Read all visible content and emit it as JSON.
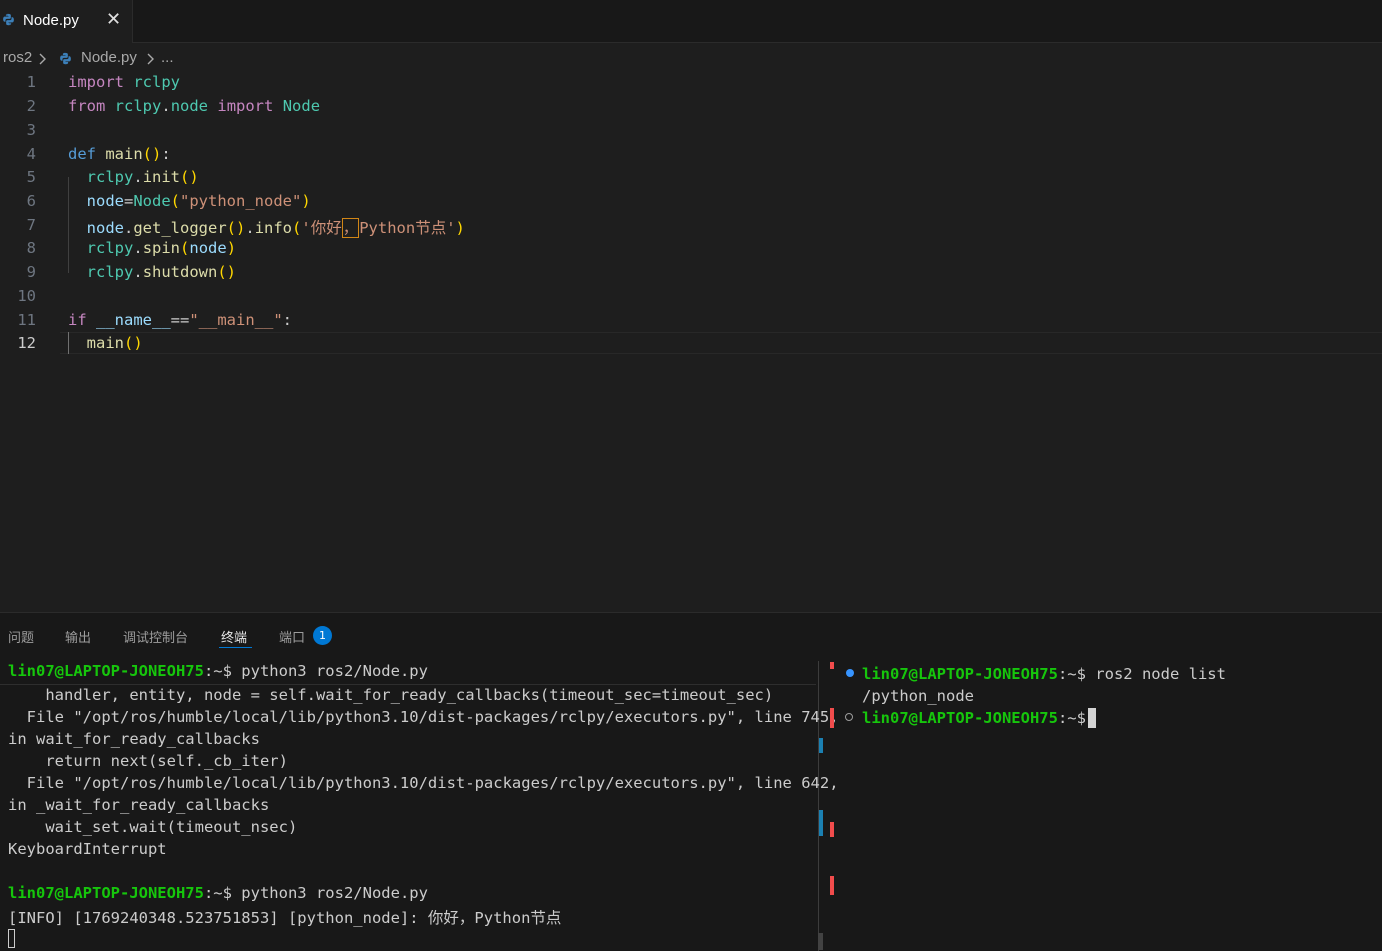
{
  "tab": {
    "filename": "Node.py",
    "close_glyph": "✕"
  },
  "breadcrumb": {
    "folder": "ros2",
    "file": "Node.py",
    "more": "..."
  },
  "editor": {
    "line_numbers": [
      "1",
      "2",
      "3",
      "4",
      "5",
      "6",
      "7",
      "8",
      "9",
      "10",
      "11",
      "12"
    ],
    "active_line": "12",
    "tokens": {
      "l1_import": "import",
      "l1_mod": "rclpy",
      "l2_from": "from",
      "l2_pkg": "rclpy",
      "l2_dot": ".",
      "l2_sub": "node",
      "l2_import": "import",
      "l2_cls": "Node",
      "l4_def": "def",
      "l4_fn": "main",
      "l4_paren": "()",
      "l4_colon": ":",
      "l5_obj": "rclpy",
      "l5_dot": ".",
      "l5_fn": "init",
      "l5_paren": "()",
      "l6_var": "node",
      "l6_eq": "=",
      "l6_cls": "Node",
      "l6_open": "(",
      "l6_str": "\"python_node\"",
      "l6_close": ")",
      "l7_var": "node",
      "l7_dot": ".",
      "l7_fn": "get_logger",
      "l7_paren1": "()",
      "l7_dot2": ".",
      "l7_fn2": "info",
      "l7_open": "(",
      "l7_str_a": "'你好",
      "l7_str_comma": "，",
      "l7_str_b": "Python节点'",
      "l7_close": ")",
      "l8_obj": "rclpy",
      "l8_dot": ".",
      "l8_fn": "spin",
      "l8_open": "(",
      "l8_arg": "node",
      "l8_close": ")",
      "l9_obj": "rclpy",
      "l9_dot": ".",
      "l9_fn": "shutdown",
      "l9_paren": "()",
      "l11_if": "if",
      "l11_name": "__name__",
      "l11_eq": "==",
      "l11_str": "\"__main__\"",
      "l11_colon": ":",
      "l12_fn": "main",
      "l12_paren": "()"
    }
  },
  "panel": {
    "tabs": [
      "问题",
      "输出",
      "调试控制台",
      "终端",
      "端口"
    ],
    "active_tab": "终端",
    "ports_badge": "1"
  },
  "terminal_left": {
    "prompt1": "lin07@LAPTOP-JONEOH75",
    "prompt_suffix": ":~$",
    "cmd1": " python3 ros2/Node.py",
    "trace": [
      "    handler, entity, node = self.wait_for_ready_callbacks(timeout_sec=timeout_sec)",
      "  File \"/opt/ros/humble/local/lib/python3.10/dist-packages/rclpy/executors.py\", line 745,",
      "in wait_for_ready_callbacks",
      "    return next(self._cb_iter)",
      "  File \"/opt/ros/humble/local/lib/python3.10/dist-packages/rclpy/executors.py\", line 642,",
      "in _wait_for_ready_callbacks",
      "    wait_set.wait(timeout_nsec)",
      "KeyboardInterrupt"
    ],
    "prompt2": "lin07@LAPTOP-JONEOH75",
    "cmd2": " python3 ros2/Node.py",
    "info_line": "[INFO] [1769240348.523751853] [python_node]: 你好，Python节点"
  },
  "terminal_right": {
    "prompt": "lin07@LAPTOP-JONEOH75",
    "prompt_suffix": ":~$",
    "cmd": " ros2 node list",
    "output": "/python_node"
  },
  "colors": {
    "background": "#1e1e1e",
    "prompt_green": "#16c60c",
    "accent_blue": "#0078d4",
    "error_red": "#f14c4c"
  }
}
